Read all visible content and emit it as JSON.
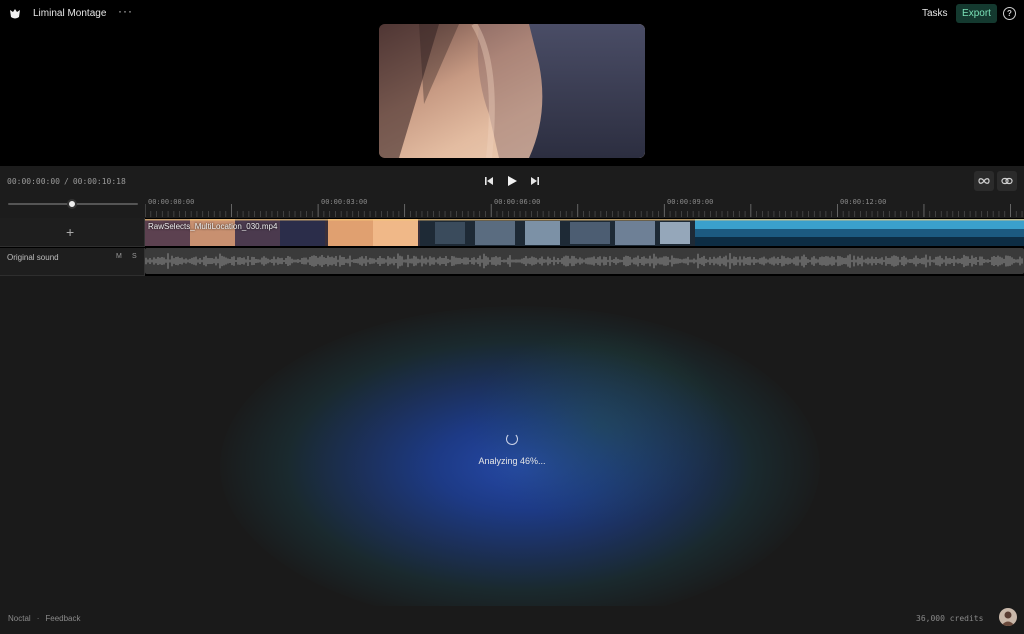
{
  "app": {
    "project_title": "Liminal Montage",
    "more_icon": "more-horizontal-icon",
    "tasks_label": "Tasks",
    "export_label": "Export",
    "help_icon": "?",
    "accent_color": "#7be2b8"
  },
  "transport": {
    "current_time": "00:00:00:00",
    "separator": "/",
    "total_time": "00:00:10:18",
    "controls": [
      "skip-back-icon",
      "play-icon",
      "skip-forward-icon"
    ],
    "tools": [
      "infinity-loop-icon",
      "link-icon"
    ]
  },
  "ruler": {
    "labels": [
      "00:00:00:00",
      "00:00:03:00",
      "00:00:06:00",
      "00:00:09:00",
      "00:00:12:00"
    ]
  },
  "tracks": {
    "add_icon": "+",
    "video_clip_name": "RawSelects_MultiLocation_030.mp4",
    "audio_label": "Original sound",
    "mute_label": "M",
    "solo_label": "S"
  },
  "status": {
    "analyzing_text": "Analyzing 46%..."
  },
  "footer": {
    "brand": "Noctal",
    "dot": "·",
    "feedback": "Feedback",
    "credits": "36,000 credits"
  }
}
